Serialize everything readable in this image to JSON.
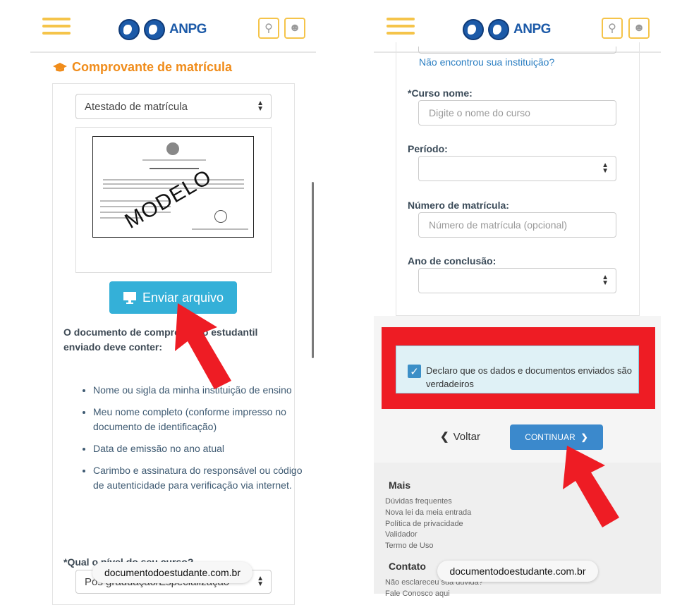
{
  "left": {
    "section_title": "Comprovante de matrícula",
    "doc_type_select": "Atestado de matrícula",
    "preview_watermark": "MODELO",
    "upload_button": "Enviar arquivo",
    "requirements_heading": "O documento de comprovação estudantil enviado deve conter:",
    "requirements": [
      "Nome ou sigla da minha instituição de ensino",
      "Meu nome completo (conforme impresso no documento de identificação)",
      "Data de emissão no ano atual",
      "Carimbo e assinatura do responsável ou código de autenticidade para verificação via internet."
    ],
    "question_label": "*Qual o nível do seu curso?",
    "level_select": "Pós graduação/Especialização",
    "url_pill": "documentodoestudante.com.br"
  },
  "right": {
    "institution_link": "Não encontrou sua instituição?",
    "course_label": "*Curso nome:",
    "course_placeholder": "Digite o nome do curso",
    "period_label": "Período:",
    "enrollment_label": "Número de matrícula:",
    "enrollment_placeholder": "Número de matrícula (opcional)",
    "conclusion_label": "Ano de conclusão:",
    "declaration": "Declaro que os dados e documentos enviados são verdadeiros",
    "back_label": "Voltar",
    "continue_label": "CONTINUAR",
    "footer_more_heading": "Mais",
    "footer_links": [
      "Dúvidas frequentes",
      "Nova lei da meia entrada",
      "Política de privacidade",
      "Validador",
      "Termo de Uso"
    ],
    "footer_contact_heading": "Contato",
    "footer_contact_links": [
      "Não esclareceu sua dúvida?",
      "Fale Conosco aqui"
    ],
    "url_pill": "documentodoestudante.com.br"
  },
  "header": {
    "logo_une": "UNE",
    "logo_ubes": "UBES",
    "logo_anpg": "ANPG"
  },
  "colors": {
    "accent_orange": "#f08c1a",
    "header_yellow": "#f5c44a",
    "upload_blue": "#34b0d8",
    "continue_blue": "#3b89cc",
    "highlight_red": "#ee1c24"
  }
}
